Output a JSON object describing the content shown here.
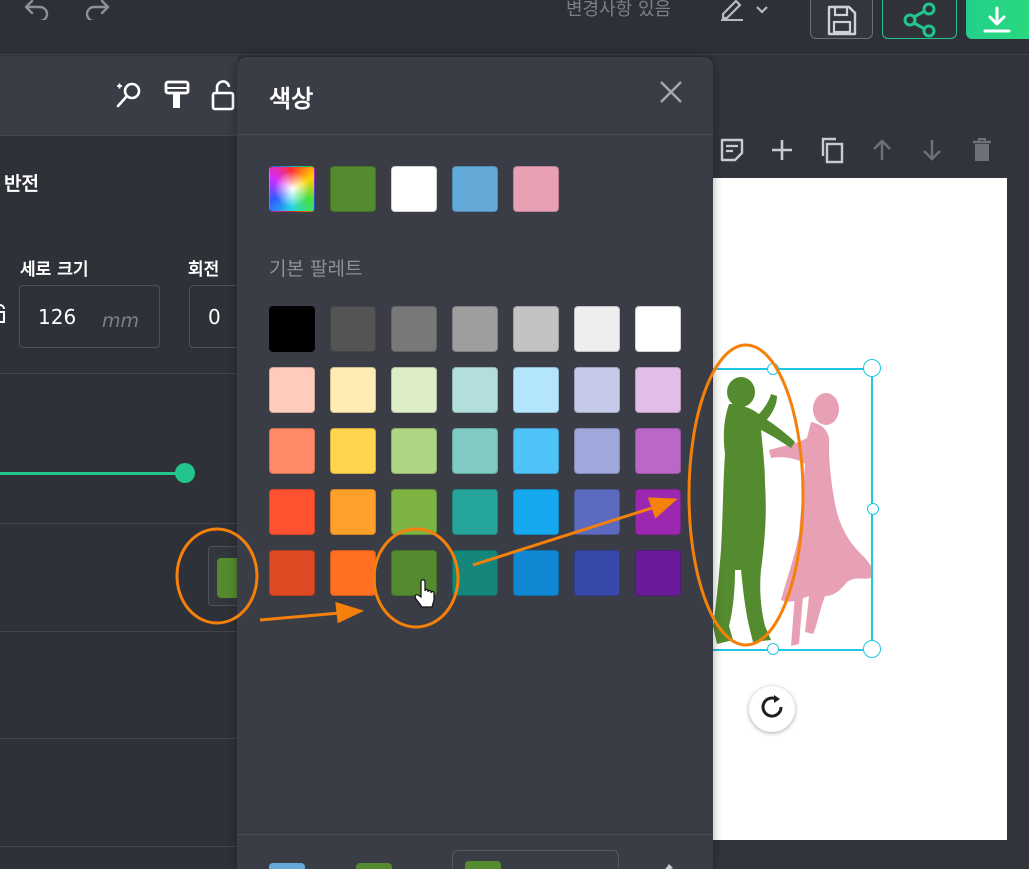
{
  "topbar": {
    "undo_icon": "undo-icon",
    "redo_icon": "redo-icon",
    "status_text": "변경사항 있음",
    "edit_icon": "pen-icon",
    "dropdown_icon": "chevron-down-icon",
    "save_icon": "floppy-disk-icon",
    "share_icon": "share-icon",
    "download_icon": "download-icon",
    "accent_color": "#22c58b"
  },
  "left_panel": {
    "header_icons": [
      "magic-wand-icon",
      "paint-roller-icon",
      "lock-open-icon"
    ],
    "flip_label": "반전",
    "height_label": "세로 크기",
    "height_value": "126",
    "height_unit": "mm",
    "rotate_label": "회전",
    "rotate_value": "0",
    "slider_color": "#22c58b",
    "current_color": "#558b2f"
  },
  "color_popup": {
    "title": "색상",
    "close_icon": "close-icon",
    "recent_colors": [
      "rainbow",
      "#558b2f",
      "#ffffff",
      "#64aad8",
      "#e8a0b4"
    ],
    "palette_label": "기본 팔레트",
    "palette": [
      [
        "#000000",
        "#555555",
        "#787878",
        "#9e9e9e",
        "#c2c2c2",
        "#eeeeee",
        "#ffffff"
      ],
      [
        "#ffccbc",
        "#ffecb3",
        "#dcedc8",
        "#b2dfdb",
        "#b3e5fc",
        "#c5cae9",
        "#e1bee7"
      ],
      [
        "#ff8a65",
        "#ffd54f",
        "#aed581",
        "#80cbc4",
        "#4fc3f7",
        "#9fa8da",
        "#ba68c8"
      ],
      [
        "#ff5230",
        "#ffa02a",
        "#7cb342",
        "#26a69a",
        "#16a8ef",
        "#5c6bc0",
        "#9c27b0"
      ],
      [
        "#dd4b25",
        "#ff7022",
        "#558b2f",
        "#14877a",
        "#1088d3",
        "#3949ab",
        "#6a1b9a"
      ]
    ],
    "footer_colors": [
      "#64aad8",
      "#558b2f"
    ],
    "footer_selected": "#558b2f"
  },
  "canvas": {
    "toolbar_icons": [
      "note-icon",
      "plus-icon",
      "duplicate-icon",
      "arrow-up-icon",
      "arrow-down-icon",
      "trash-icon"
    ],
    "rotate_icon": "rotate-icon",
    "selection_color": "#1fc7e3",
    "figure_colors": [
      "#558b2f",
      "#e8a0b4"
    ]
  },
  "annotations": {
    "highlight_color": "#f5800a"
  }
}
